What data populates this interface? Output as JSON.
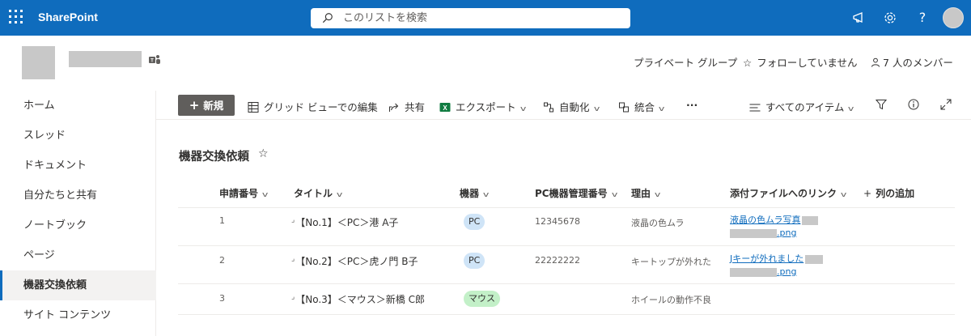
{
  "suite": {
    "brand": "SharePoint",
    "search_placeholder": "このリストを検索",
    "help_label": "?"
  },
  "site": {
    "links": {
      "private_group": "プライベート グループ",
      "follow": "フォローしていません",
      "members": "7 人のメンバー"
    }
  },
  "nav": {
    "items": [
      {
        "label": "ホーム"
      },
      {
        "label": "スレッド"
      },
      {
        "label": "ドキュメント"
      },
      {
        "label": "自分たちと共有"
      },
      {
        "label": "ノートブック"
      },
      {
        "label": "ページ"
      },
      {
        "label": "機器交換依頼",
        "active": true
      },
      {
        "label": "サイト コンテンツ"
      }
    ]
  },
  "commands": {
    "new": "新規",
    "grid_edit": "グリッド ビューでの編集",
    "share": "共有",
    "export": "エクスポート",
    "automate": "自動化",
    "integrate": "統合",
    "more": "···",
    "view": "すべてのアイテム"
  },
  "list": {
    "title": "機器交換依頼",
    "columns": {
      "id": "申請番号",
      "title": "タイトル",
      "device": "機器",
      "pc_number": "PC機器管理番号",
      "reason": "理由",
      "attachment": "添付ファイルへのリンク",
      "add_column": "列の追加"
    },
    "rows": [
      {
        "id": "1",
        "title": "【No.1】＜PC＞港 A子",
        "device": "PC",
        "pc_number": "12345678",
        "reason": "液晶の色ムラ",
        "link_line1": "液晶の色ムラ写真",
        "link_line2": ".png"
      },
      {
        "id": "2",
        "title": "【No.2】＜PC＞虎ノ門 B子",
        "device": "PC",
        "pc_number": "22222222",
        "reason": "キートップが外れた",
        "link_line1": "Jキーが外れました",
        "link_line2": ".png"
      },
      {
        "id": "3",
        "title": "【No.3】＜マウス＞新橋 C郎",
        "device": "マウス",
        "pc_number": "",
        "reason": "ホイールの動作不良",
        "link_line1": "",
        "link_line2": ""
      }
    ]
  },
  "colors": {
    "suite_bar": "#0f6cbd",
    "pill_pc": "#cfe4f7",
    "pill_mouse": "#c3f0c8",
    "new_button": "#605e5c",
    "link": "#0f6cbd"
  }
}
